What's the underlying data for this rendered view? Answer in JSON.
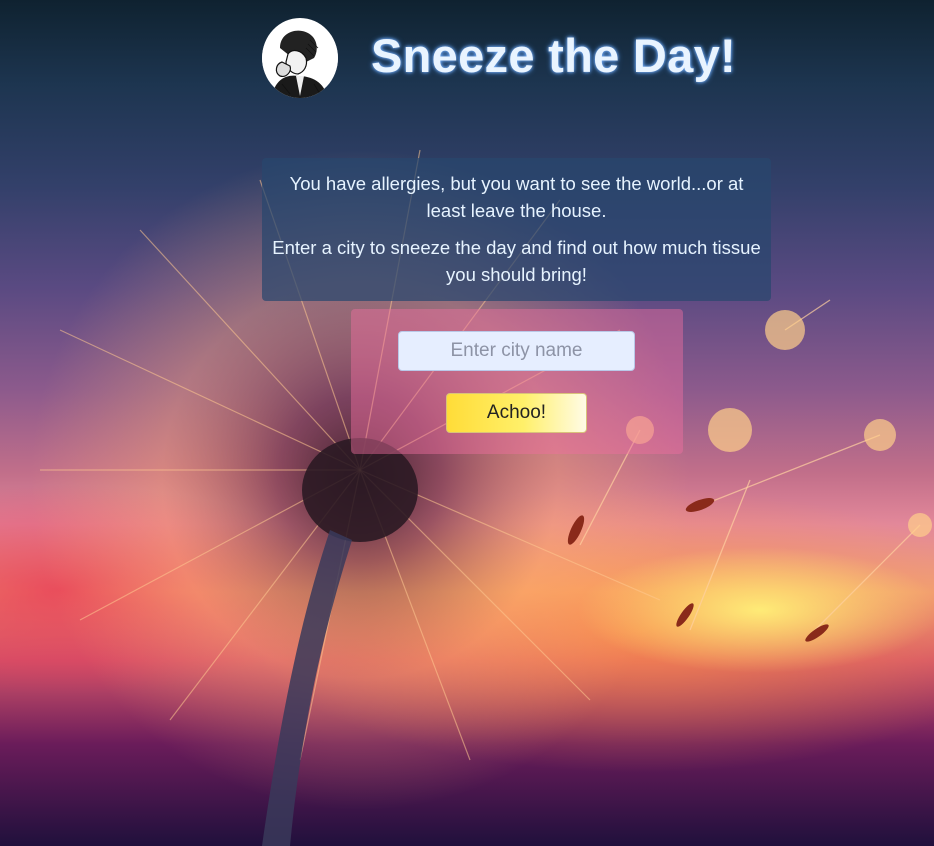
{
  "header": {
    "title": "Sneeze the Day!",
    "logo_icon": "sneezing-man-icon"
  },
  "intro": {
    "line1": "You have allergies, but you want to see the world...or at least leave the house.",
    "line2": "Enter a city to sneeze the day and find out how much tissue you should bring!"
  },
  "search": {
    "placeholder": "Enter city name",
    "value": "",
    "button_label": "Achoo!"
  },
  "background": {
    "subject": "dandelion-at-sunset",
    "colors": {
      "sky_top": "#1d3550",
      "sky_mid": "#8c5a8c",
      "glow": "#ffd24a",
      "seed_head": "#ffb070"
    }
  }
}
